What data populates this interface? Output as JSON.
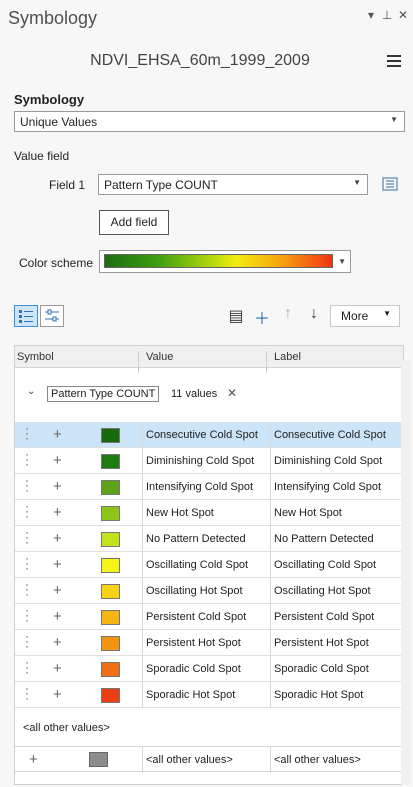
{
  "window": {
    "title": "Symbology",
    "layer_name": "NDVI_EHSA_60m_1999_2009"
  },
  "symbology": {
    "section_label": "Symbology",
    "method": "Unique Values",
    "value_field_label": "Value field",
    "field1_label": "Field 1",
    "field1_value": "Pattern Type COUNT",
    "add_field_label": "Add field",
    "color_scheme_label": "Color scheme"
  },
  "toolbar": {
    "more_label": "More"
  },
  "grid": {
    "headers": {
      "symbol": "Symbol",
      "value": "Value",
      "label": "Label"
    },
    "group_field": "Pattern Type COUNT",
    "group_count": "11 values",
    "rows": [
      {
        "value": "Consecutive Cold Spot",
        "label": "Consecutive Cold Spot",
        "color": "#186b0c"
      },
      {
        "value": "Diminishing Cold Spot",
        "label": "Diminishing Cold Spot",
        "color": "#1e7d10"
      },
      {
        "value": "Intensifying Cold Spot",
        "label": "Intensifying Cold Spot",
        "color": "#5ea218"
      },
      {
        "value": "New Hot Spot",
        "label": "New Hot Spot",
        "color": "#8ec519"
      },
      {
        "value": "No Pattern Detected",
        "label": "No Pattern Detected",
        "color": "#c4e21a"
      },
      {
        "value": "Oscillating Cold Spot",
        "label": "Oscillating Cold Spot",
        "color": "#f4f419"
      },
      {
        "value": "Oscillating Hot Spot",
        "label": "Oscillating Hot Spot",
        "color": "#f7d410"
      },
      {
        "value": "Persistent Cold Spot",
        "label": "Persistent Cold Spot",
        "color": "#f5b512"
      },
      {
        "value": "Persistent Hot Spot",
        "label": "Persistent Hot Spot",
        "color": "#f39513"
      },
      {
        "value": "Sporadic Cold Spot",
        "label": "Sporadic Cold Spot",
        "color": "#f06f15"
      },
      {
        "value": "Sporadic Hot Spot",
        "label": "Sporadic Hot Spot",
        "color": "#ec3e15"
      }
    ],
    "other_section_label": "<all other values>",
    "other_row": {
      "value": "<all other values>",
      "label": "<all other values>",
      "color": "#8c8c8c"
    }
  }
}
